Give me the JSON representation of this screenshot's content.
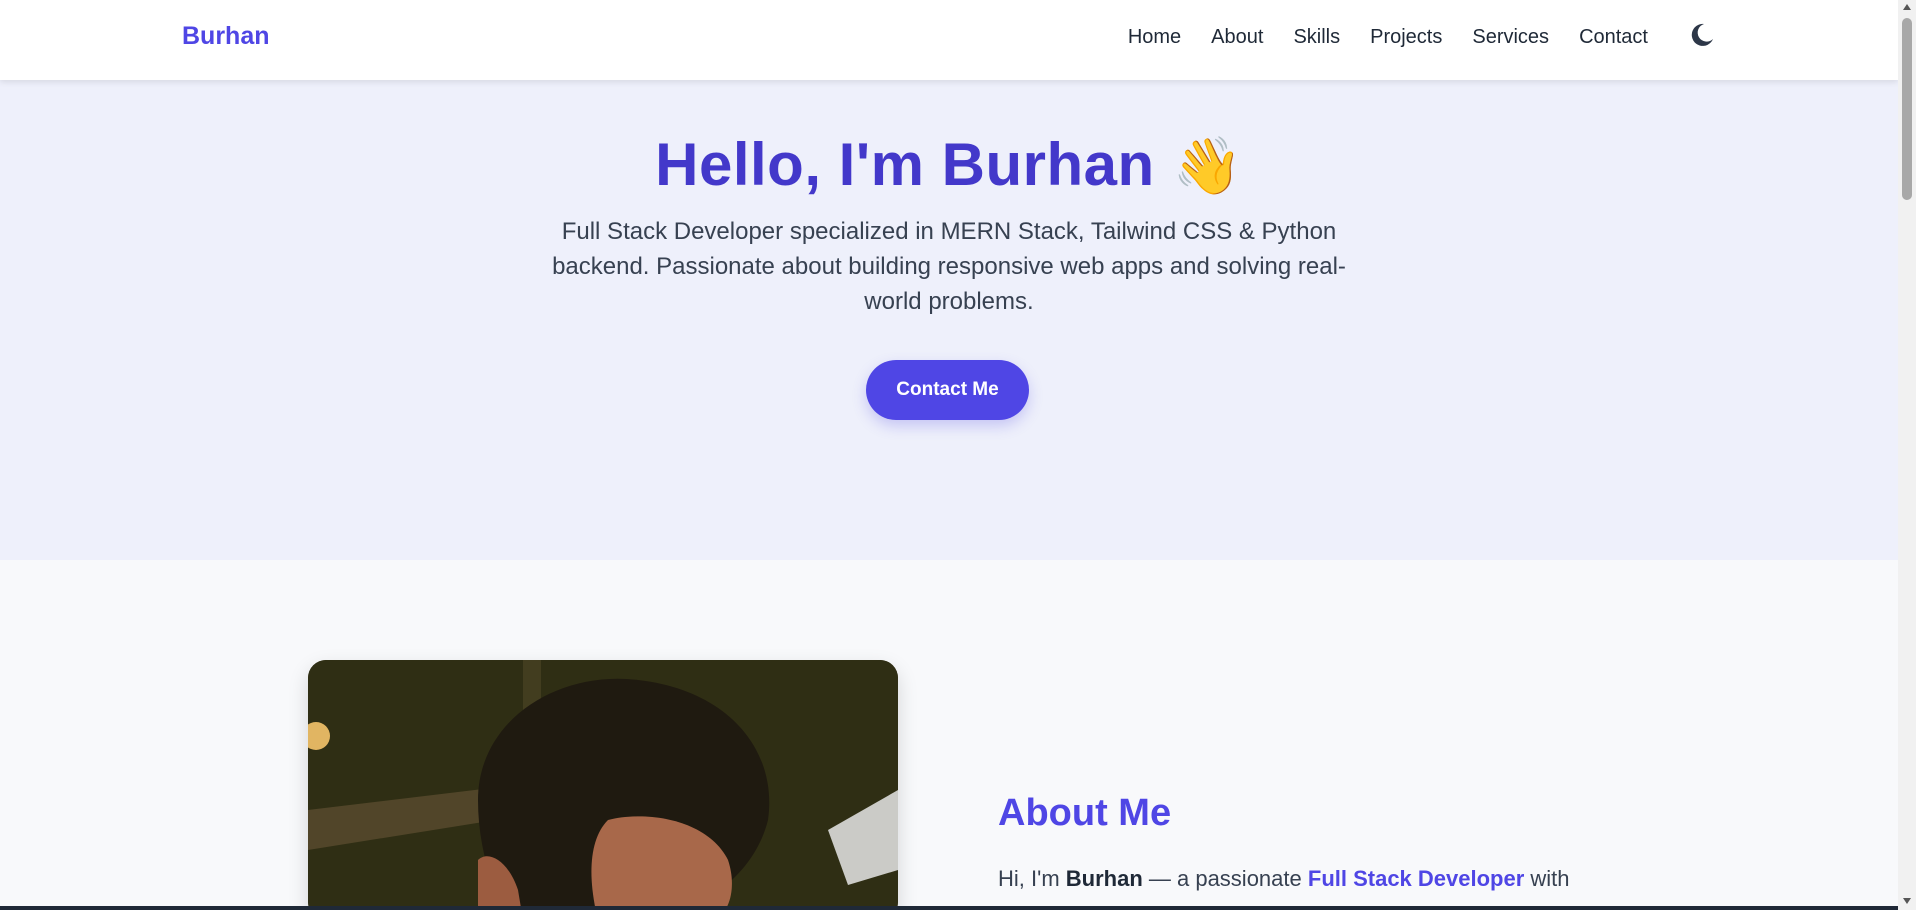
{
  "navbar": {
    "brand": "Burhan",
    "links": [
      "Home",
      "About",
      "Skills",
      "Projects",
      "Services",
      "Contact"
    ],
    "theme_toggle_icon": "moon-icon"
  },
  "hero": {
    "title": "Hello, I'm Burhan",
    "wave_emoji": "👋",
    "subtitle": "Full Stack Developer specialized in MERN Stack, Tailwind CSS & Python backend. Passionate about building responsive web apps and solving real-world problems.",
    "cta_label": "Contact Me"
  },
  "about": {
    "title": "About Me",
    "intro_prefix": "Hi, I'm ",
    "intro_name": "Burhan",
    "intro_mid": " — a passionate ",
    "intro_role": "Full Stack Developer",
    "intro_suffix": " with"
  },
  "colors": {
    "accent": "#4f46e5",
    "hero_title": "#4338ca",
    "hero_bg": "#eef0fb",
    "page_bg": "#f8f9fb"
  }
}
